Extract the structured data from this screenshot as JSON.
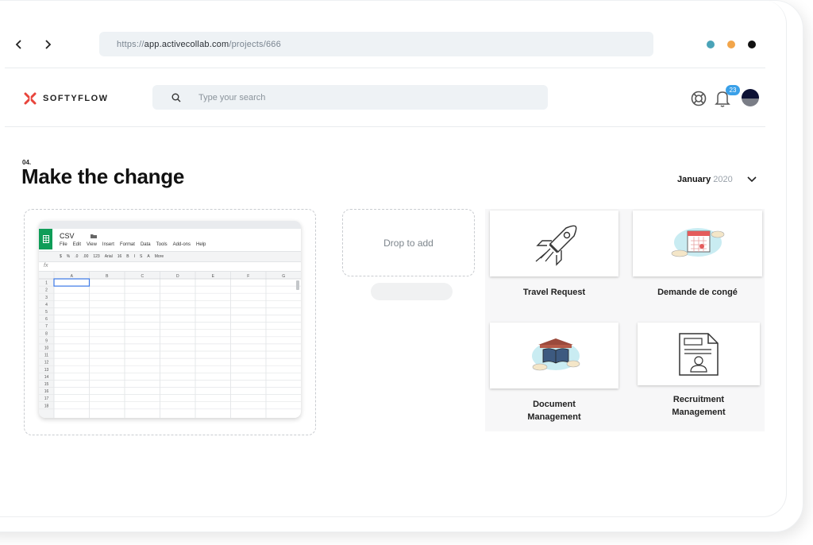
{
  "browser": {
    "back_icon": "chevron-left-icon",
    "forward_icon": "chevron-right-icon",
    "url_prefix": "https://",
    "url_domain": "app.activecollab.com",
    "url_path": "/projects/666",
    "window_dots": [
      "#4aa3b8",
      "#f2a54a",
      "#111111"
    ]
  },
  "app": {
    "logo_text": "SOFTYFLOW",
    "search_placeholder": "Type your search",
    "notification_count": "23"
  },
  "page": {
    "step": "04.",
    "title": "Make the change",
    "month": "January",
    "year": "2020"
  },
  "sheet": {
    "name": "CSV",
    "menu": [
      "File",
      "Edit",
      "View",
      "Insert",
      "Format",
      "Data",
      "Tools",
      "Add-ons",
      "Help"
    ],
    "toolbar": [
      "$",
      "%",
      ".0",
      ".00",
      "123",
      "Arial",
      "16",
      "B",
      "I",
      "S",
      "A",
      "More"
    ],
    "fx": "fx",
    "columns": [
      "A",
      "B",
      "C",
      "D",
      "E",
      "F",
      "G"
    ],
    "rows": [
      "1",
      "2",
      "3",
      "4",
      "5",
      "6",
      "7",
      "8",
      "9",
      "10",
      "11",
      "12",
      "13",
      "14",
      "15",
      "16",
      "17",
      "18"
    ]
  },
  "drop": {
    "label": "Drop to add"
  },
  "cards": [
    {
      "label": "Travel Request",
      "icon": "rocket-icon"
    },
    {
      "label": "Demande de congé",
      "icon": "calendar-icon"
    },
    {
      "label_line1": "Document",
      "label_line2": "Management",
      "icon": "book-icon"
    },
    {
      "label_line1": "Recruitment",
      "label_line2": "Management",
      "icon": "resume-icon"
    }
  ]
}
